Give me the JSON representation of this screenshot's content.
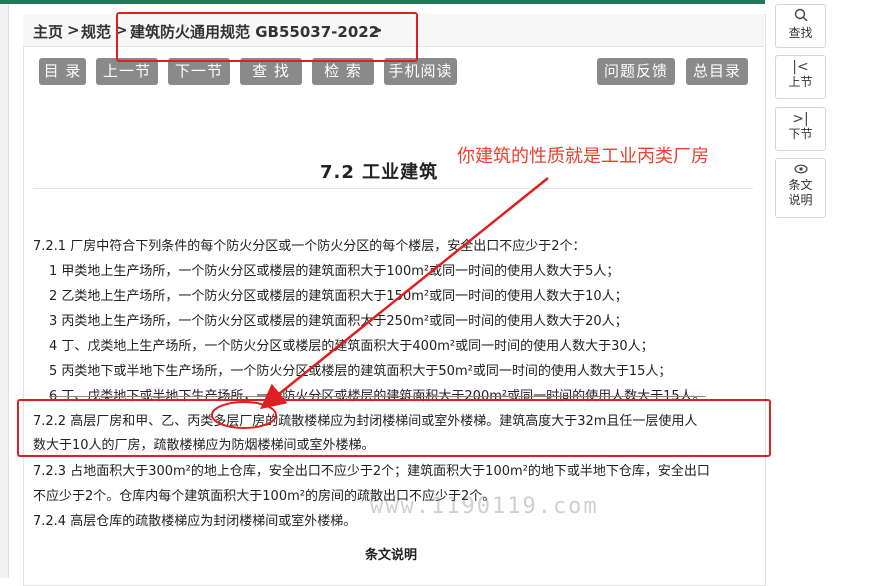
{
  "breadcrumb": {
    "home": "主页",
    "sep1": ">",
    "spec": "规范",
    "sep2": ">",
    "standard": "建筑防火通用规范 GB55037-2022",
    "sep3": ">"
  },
  "toolbar": {
    "toc": "目 录",
    "prev": "上一节",
    "next": "下一节",
    "find": "查 找",
    "search": "检 索",
    "mobile": "手机阅读",
    "feedback": "问题反馈",
    "master_toc": "总目录"
  },
  "section": {
    "title": "7.2 工业建筑"
  },
  "annotation": "你建筑的性质就是工业丙类厂房",
  "clauses": {
    "c721": "7.2.1 厂房中符合下列条件的每个防火分区或一个防火分区的每个楼层，安全出口不应少于2个：",
    "items": [
      "1 甲类地上生产场所，一个防火分区或楼层的建筑面积大于100m²或同一时间的使用人数大于5人；",
      "2 乙类地上生产场所，一个防火分区或楼层的建筑面积大于150m²或同一时间的使用人数大于10人；",
      "3 丙类地上生产场所，一个防火分区或楼层的建筑面积大于250m²或同一时间的使用人数大于20人；",
      "4 丁、戊类地上生产场所，一个防火分区或楼层的建筑面积大于400m²或同一时间的使用人数大于30人；",
      "5 丙类地下或半地下生产场所，一个防火分区或楼层的建筑面积大于50m²或同一时间的使用人数大于15人；",
      "6 丁、戊类地下或半地下生产场所，一个防火分区或楼层的建筑面积大于200m²或同一时间的使用人数大于15人。"
    ],
    "c722_line1": "7.2.2 高层厂房和甲、乙、丙类多层厂房的疏散楼梯应为封闭楼梯间或室外楼梯。建筑高度大于32m且任一层使用人",
    "c722_line2": "数大于10人的厂房，疏散楼梯应为防烟楼梯间或室外楼梯。",
    "c723_line1": "7.2.3 占地面积大于300m²的地上仓库，安全出口不应少于2个；建筑面积大于100m²的地下或半地下仓库，安全出口",
    "c723_line2": "不应少于2个。仓库内每个建筑面积大于100m²的房间的疏散出口不应少于2个。",
    "c724": "7.2.4 高层仓库的疏散楼梯应为封闭楼梯间或室外楼梯。"
  },
  "clause_explanation": "条文说明",
  "watermark": "www.1190119.com",
  "sidebar": {
    "find": "查找",
    "prev": "上节",
    "next": "下节",
    "explain_line1": "条文",
    "explain_line2": "说明",
    "icons": [
      "search-icon",
      "first-page-icon",
      "last-page-icon",
      "eye-icon"
    ]
  },
  "colors": {
    "accent_green": "#1f7a55",
    "annotation_red": "#e02020",
    "button_gray": "#8a8a8a"
  }
}
